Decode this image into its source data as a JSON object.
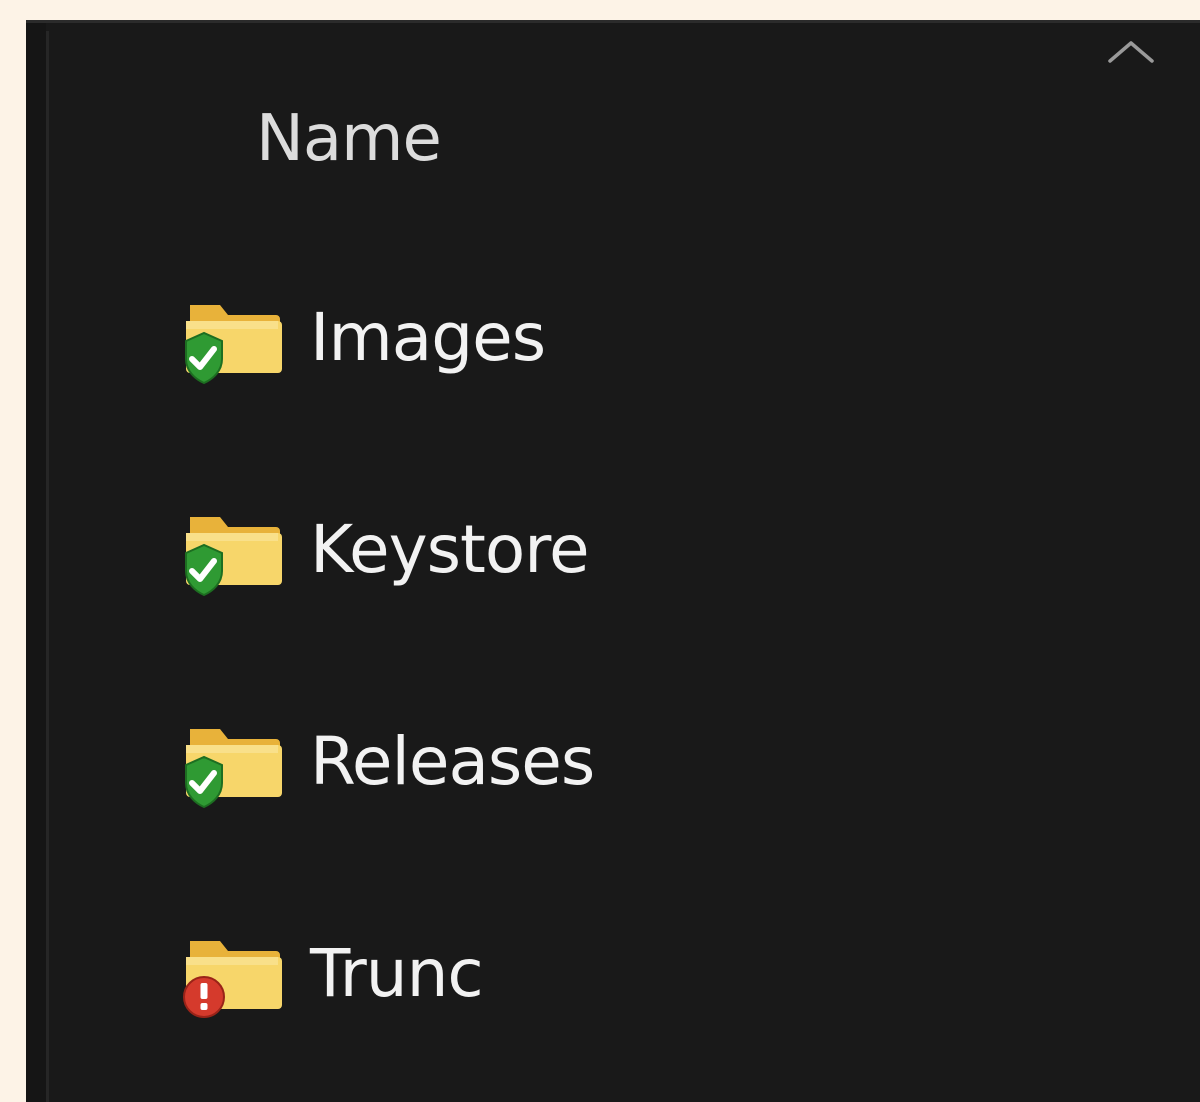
{
  "column_header": {
    "name_label": "Name",
    "sort_icon": "chevron-up-icon"
  },
  "items": [
    {
      "label": "Images",
      "type": "folder",
      "status": "synced",
      "status_icon": "green-check-overlay-icon"
    },
    {
      "label": "Keystore",
      "type": "folder",
      "status": "synced",
      "status_icon": "green-check-overlay-icon"
    },
    {
      "label": "Releases",
      "type": "folder",
      "status": "synced",
      "status_icon": "green-check-overlay-icon"
    },
    {
      "label": "Trunc",
      "type": "folder",
      "status": "error",
      "status_icon": "red-exclamation-overlay-icon"
    }
  ],
  "colors": {
    "background": "#191919",
    "text": "#f2f2f2",
    "folder": "#f5c84c",
    "synced": "#2f9a33",
    "error": "#d53a2c"
  }
}
